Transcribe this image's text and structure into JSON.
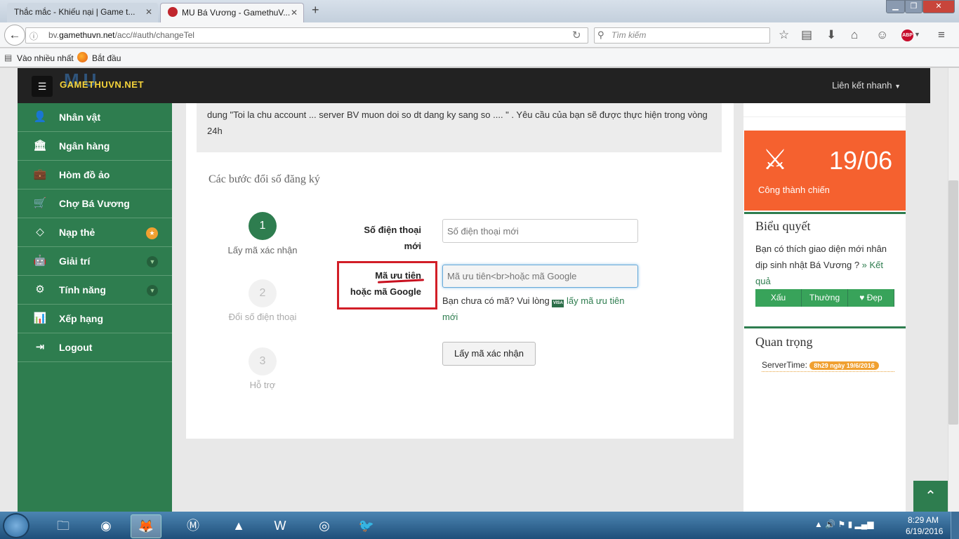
{
  "browser": {
    "tabs": [
      {
        "label": "Thắc mắc - Khiếu nại | Game t..."
      },
      {
        "label": "MU Bá Vương - GamethuV..."
      }
    ],
    "url_prefix": "bv.",
    "url_domain": "gamethuvn.net",
    "url_path": "/acc/#auth/changeTel",
    "search_placeholder": "Tìm kiếm",
    "bookmarks": [
      {
        "label": "Vào nhiều nhất"
      },
      {
        "label": "Bắt đầu"
      }
    ]
  },
  "header": {
    "logo_text": "GAMETHUVN.NET",
    "logo_mark": "MU",
    "quick_links": "Liên kết nhanh"
  },
  "sidebar": {
    "items": [
      {
        "label": "Nhân vật",
        "icon": "user-icon"
      },
      {
        "label": "Ngân hàng",
        "icon": "bank-icon"
      },
      {
        "label": "Hòm đồ ảo",
        "icon": "briefcase-icon"
      },
      {
        "label": "Chợ Bá Vương",
        "icon": "cart-icon"
      },
      {
        "label": "Nạp thẻ",
        "icon": "diamond-icon"
      },
      {
        "label": "Giải trí",
        "icon": "android-icon"
      },
      {
        "label": "Tính năng",
        "icon": "gears-icon"
      },
      {
        "label": "Xếp hạng",
        "icon": "bar-chart-icon"
      },
      {
        "label": "Logout",
        "icon": "logout-icon"
      }
    ]
  },
  "notice": {
    "line1": "dung \"Toi la chu account ... server BV muon doi so dt dang ky sang so .... \" . Yêu cầu của bạn sẽ được thực hiện trong vòng",
    "line2": "24h"
  },
  "steps": {
    "title": "Các bước đổi số đăng ký",
    "items": [
      {
        "number": "1",
        "label": "Lấy mã xác nhận",
        "active": true
      },
      {
        "number": "2",
        "label": "Đổi số điện thoại",
        "active": false
      },
      {
        "number": "3",
        "label": "Hỗ trợ",
        "active": false
      }
    ]
  },
  "form": {
    "phone_label_1": "Số điện thoại",
    "phone_label_2": "mới",
    "phone_placeholder": "Số điện thoại mới",
    "code_label_1": "Mã ưu tiên",
    "code_label_2": "hoặc mã Google",
    "code_placeholder": "Mã ưu tiên<br>hoặc mã Google",
    "hint_text": "Bạn chưa có mã? Vui lòng",
    "hint_link": "lấy mã ưu tiên mới",
    "submit_label": "Lấy mã xác nhận"
  },
  "right": {
    "event_date": "19/06",
    "event_name": "Công thành chiến",
    "poll_title": "Biểu quyết",
    "poll_question": "Bạn có thích giao diện mới nhân dịp sinh nhật Bá Vương ?",
    "poll_result_link": "» Kết quả",
    "poll_options": [
      {
        "label": "Xấu"
      },
      {
        "label": "Thường"
      },
      {
        "label": "♥ Đẹp"
      }
    ],
    "important_title": "Quan trọng",
    "server_time_label": "ServerTime:",
    "server_time_value": "8h29 ngày 19/6/2016"
  },
  "taskbar": {
    "time": "8:29 AM",
    "date": "6/19/2016"
  },
  "colors": {
    "brand_green": "#2e7d4f",
    "event_orange": "#f5612f",
    "highlight_red": "#d21e27"
  }
}
